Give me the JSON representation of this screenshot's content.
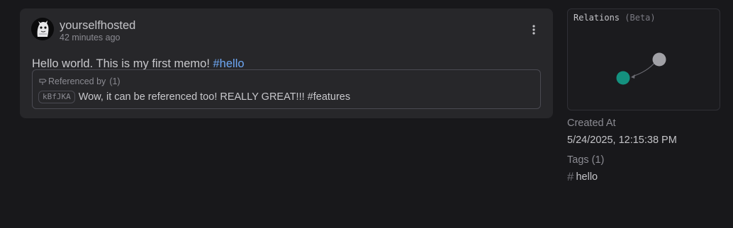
{
  "memo": {
    "creator_name": "yourselfhosted",
    "relative_time": "42 minutes ago",
    "content_text": "Hello world. This is my first memo! ",
    "content_tag": "#hello",
    "more_icon": "more-vertical-icon",
    "referenced_by": {
      "label": "Referenced by",
      "count": "(1)",
      "icon": "milestone-icon",
      "items": [
        {
          "id": "kBfJKA",
          "text": "Wow, it can be referenced too! REALLY GREAT!!! #features"
        }
      ]
    }
  },
  "sidebar": {
    "relations": {
      "title": "Relations",
      "beta": "(Beta)",
      "node_colors": {
        "current": "#14917f",
        "related": "#a1a1a6"
      }
    },
    "created_at": {
      "label": "Created At",
      "value": "5/24/2025, 12:15:38 PM"
    },
    "tags": {
      "label": "Tags (1)",
      "items": [
        {
          "hash": "#",
          "name": "hello"
        }
      ]
    }
  }
}
